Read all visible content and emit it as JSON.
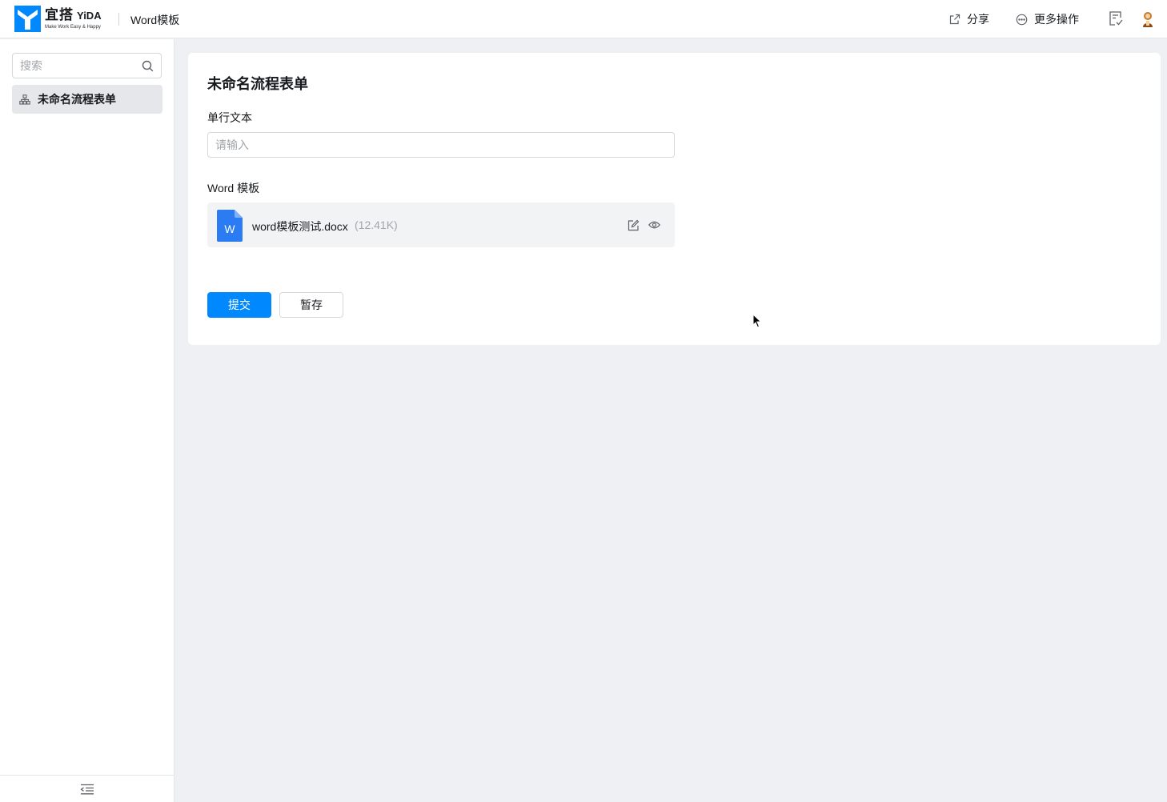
{
  "header": {
    "logo": {
      "name_cn": "宜搭",
      "name_en": "YiDA",
      "tagline": "Make Work Easy & Happy"
    },
    "app_title": "Word模板",
    "actions": [
      {
        "label": "分享",
        "icon": "share-icon"
      },
      {
        "label": "更多操作",
        "icon": "more-icon"
      }
    ],
    "icons": [
      "todo-icon",
      "avatar"
    ]
  },
  "sidebar": {
    "search_placeholder": "搜索",
    "items": [
      {
        "label": "未命名流程表单",
        "icon": "process-form-icon",
        "active": true
      }
    ],
    "footer_icon": "collapse-icon"
  },
  "form": {
    "title": "未命名流程表单",
    "text_field": {
      "label": "单行文本",
      "placeholder": "请输入",
      "value": ""
    },
    "word_template": {
      "label": "Word 模板",
      "file_name": "word模板测试.docx",
      "file_size": "(12.41K)",
      "file_icon_letter": "W"
    },
    "buttons": {
      "submit": "提交",
      "save_draft": "暂存"
    }
  },
  "colors": {
    "primary": "#0089ff",
    "word_blue": "#2b7cf2",
    "background": "#eff0f4"
  }
}
